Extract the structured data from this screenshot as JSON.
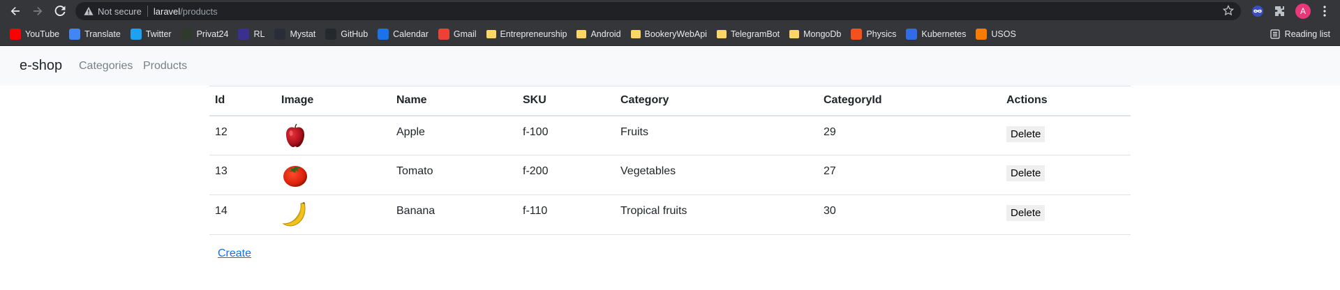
{
  "browser": {
    "security_label": "Not secure",
    "url_host": "laravel",
    "url_path": "/products",
    "avatar_letter": "A"
  },
  "bookmarks": [
    {
      "label": "YouTube",
      "icon": "youtube-icon",
      "color": "#ff0000"
    },
    {
      "label": "Translate",
      "icon": "translate-icon",
      "color": "#4285f4"
    },
    {
      "label": "Twitter",
      "icon": "twitter-icon",
      "color": "#1da1f2"
    },
    {
      "label": "Privat24",
      "icon": "privat24-icon",
      "color": "#2f3a2c"
    },
    {
      "label": "RL",
      "icon": "rl-icon",
      "color": "#3b2f8f"
    },
    {
      "label": "Mystat",
      "icon": "mystat-icon",
      "color": "#2b2c3a"
    },
    {
      "label": "GitHub",
      "icon": "github-icon",
      "color": "#24292e"
    },
    {
      "label": "Calendar",
      "icon": "calendar-icon",
      "color": "#1a73e8"
    },
    {
      "label": "Gmail",
      "icon": "gmail-icon",
      "color": "#ea4335"
    },
    {
      "label": "Entrepreneurship",
      "icon": "folder-icon",
      "color": "#fdd663"
    },
    {
      "label": "Android",
      "icon": "folder-icon",
      "color": "#fdd663"
    },
    {
      "label": "BookeryWebApi",
      "icon": "folder-icon",
      "color": "#fdd663"
    },
    {
      "label": "TelegramBot",
      "icon": "folder-icon",
      "color": "#fdd663"
    },
    {
      "label": "MongoDb",
      "icon": "folder-icon",
      "color": "#fdd663"
    },
    {
      "label": "Physics",
      "icon": "physics-icon",
      "color": "#f4511e"
    },
    {
      "label": "Kubernetes",
      "icon": "kubernetes-icon",
      "color": "#326ce5"
    },
    {
      "label": "USOS",
      "icon": "usos-icon",
      "color": "#f57c00"
    }
  ],
  "reading_list": "Reading list",
  "app": {
    "brand": "e-shop",
    "nav": [
      "Categories",
      "Products"
    ]
  },
  "table": {
    "headers": [
      "Id",
      "Image",
      "Name",
      "SKU",
      "Category",
      "CategoryId",
      "Actions"
    ],
    "rows": [
      {
        "id": "12",
        "image": "apple-icon",
        "name": "Apple",
        "sku": "f-100",
        "category": "Fruits",
        "category_id": "29",
        "action": "Delete"
      },
      {
        "id": "13",
        "image": "tomato-icon",
        "name": "Tomato",
        "sku": "f-200",
        "category": "Vegetables",
        "category_id": "27",
        "action": "Delete"
      },
      {
        "id": "14",
        "image": "banana-icon",
        "name": "Banana",
        "sku": "f-110",
        "category": "Tropical fruits",
        "category_id": "30",
        "action": "Delete"
      }
    ]
  },
  "create_link": "Create"
}
